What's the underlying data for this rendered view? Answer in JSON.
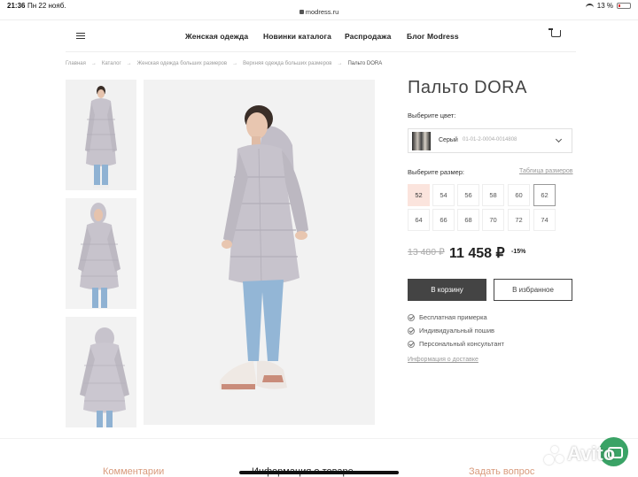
{
  "status_bar": {
    "time": "21:36",
    "date": "Пн 22 нояб.",
    "url": "modress.ru",
    "battery": "13 %"
  },
  "header": {
    "nav": [
      "Женская одежда",
      "Новинки каталога",
      "Распродажа",
      "Блог Modress"
    ]
  },
  "breadcrumb": [
    "Главная",
    "Каталог",
    "Женская одежда больших размеров",
    "Верхняя одежда больших размеров",
    "Пальто DORA"
  ],
  "product": {
    "title": "Пальто DORA",
    "color_label": "Выберите цвет:",
    "color_name": "Серый",
    "color_code": "01-01-2-0004-0014808",
    "size_label": "Выберите размер:",
    "size_chart_link": "Таблица размеров",
    "sizes": [
      "52",
      "54",
      "56",
      "58",
      "60",
      "62",
      "64",
      "66",
      "68",
      "70",
      "72",
      "74"
    ],
    "selected_size": "52",
    "old_price": "13 480 ₽",
    "new_price": "11 458 ₽",
    "discount": "-15%",
    "add_to_cart": "В корзину",
    "add_to_favorites": "В избранное",
    "features": [
      "Бесплатная примерка",
      "Индивидуальный пошив",
      "Персональный консультант"
    ],
    "delivery_link": "Информация о доставке"
  },
  "bottom_tabs": [
    "Комментарии",
    "Информация о товаре",
    "Задать вопрос"
  ],
  "watermark": "Avito",
  "colors": {
    "accent_text": "#d89a7c",
    "selected_size_bg": "#fbe4dd",
    "cart_button": "#444444",
    "chat_button": "#3aa366",
    "coat": "#c7c3cc"
  }
}
